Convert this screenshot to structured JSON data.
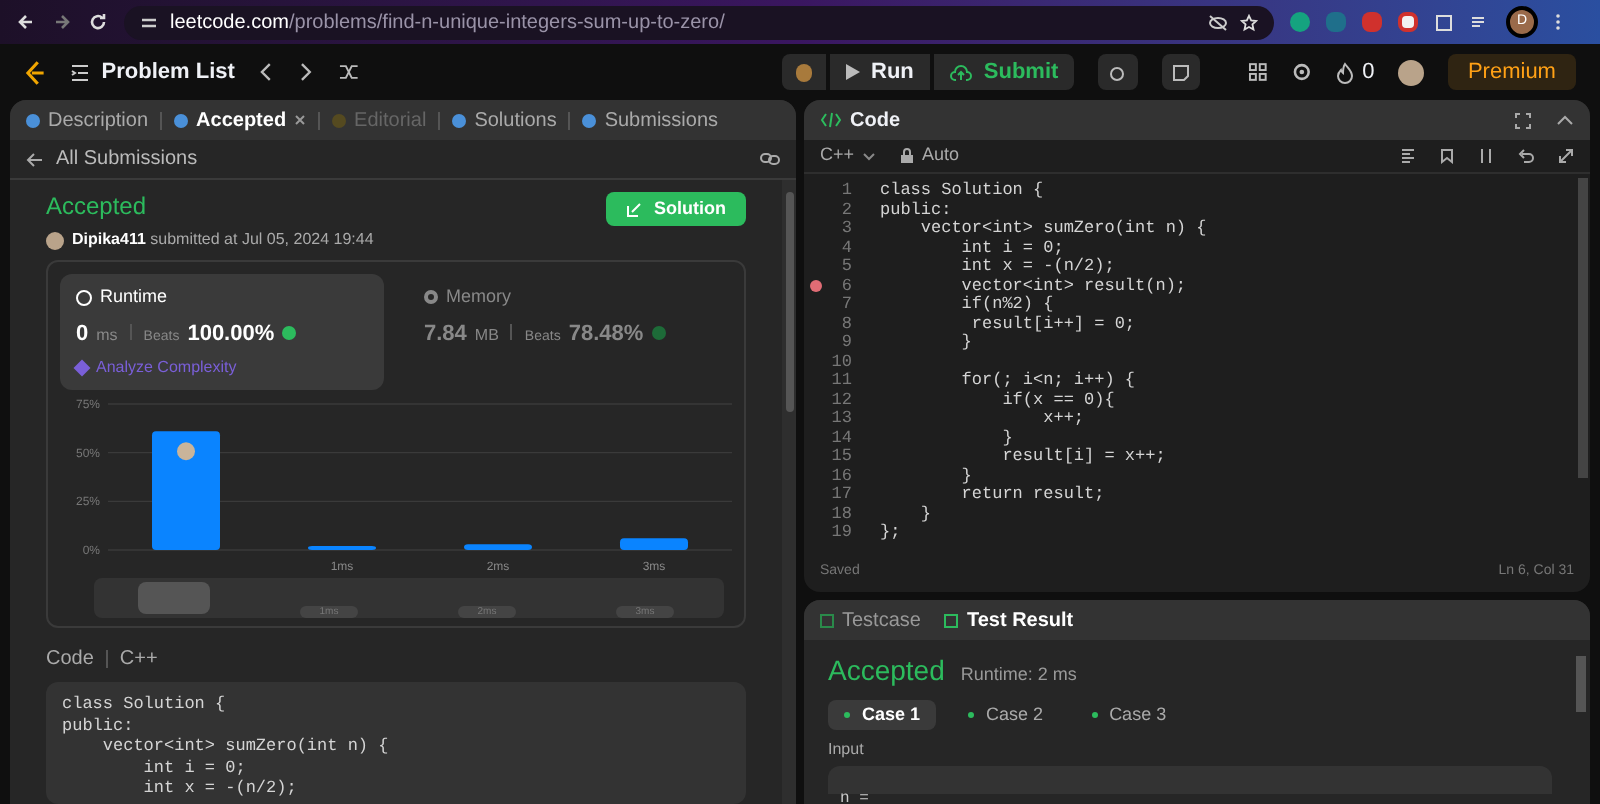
{
  "browser": {
    "url_host": "leetcode.com",
    "url_path": "/problems/find-n-unique-integers-sum-up-to-zero/",
    "profile_initial": "D"
  },
  "topbar": {
    "problem_list": "Problem List",
    "run": "Run",
    "submit": "Submit",
    "streak": "0",
    "premium": "Premium"
  },
  "left_tabs": [
    {
      "label": "Description",
      "selected": false,
      "disabled": false,
      "closable": false
    },
    {
      "label": "Accepted",
      "selected": true,
      "disabled": false,
      "closable": true
    },
    {
      "label": "Editorial",
      "selected": false,
      "disabled": true,
      "closable": false
    },
    {
      "label": "Solutions",
      "selected": false,
      "disabled": false,
      "closable": false
    },
    {
      "label": "Submissions",
      "selected": false,
      "disabled": false,
      "closable": false
    }
  ],
  "back_link": "All Submissions",
  "submission": {
    "status": "Accepted",
    "user": "Dipika411",
    "submitted": "submitted at Jul 05, 2024 19:44",
    "solution_button": "Solution"
  },
  "metrics": [
    {
      "kind": "runtime",
      "label": "Runtime",
      "value": "0",
      "unit": "ms",
      "beats_label": "Beats",
      "beats": "100.00%",
      "selected": true,
      "link": "Analyze Complexity"
    },
    {
      "kind": "memory",
      "label": "Memory",
      "value": "7.84",
      "unit": "MB",
      "beats_label": "Beats",
      "beats": "78.48%",
      "selected": false
    }
  ],
  "chart_data": {
    "type": "bar",
    "categories": [
      null,
      "1ms",
      "2ms",
      "3ms"
    ],
    "values": [
      61,
      2,
      3,
      6
    ],
    "ylim": [
      0,
      75
    ],
    "yticks": [
      {
        "value": 0,
        "label": "0%"
      },
      {
        "value": 25,
        "label": "25%"
      },
      {
        "value": 50,
        "label": "50%"
      },
      {
        "value": 75,
        "label": "75%"
      }
    ]
  },
  "brush_labels": [
    "1ms",
    "2ms",
    "3ms"
  ],
  "code_header": {
    "title": "Code",
    "language": "C++"
  },
  "left_code": [
    "class Solution {",
    "public:",
    "    vector<int> sumZero(int n) {",
    "        int i = 0;",
    "        int x = -(n/2);"
  ],
  "editor": {
    "title": "Code",
    "language": "C++",
    "mode": "Auto",
    "status": "Saved",
    "cursor": "Ln 6, Col 31",
    "lines": [
      {
        "num": "1",
        "text": "class Solution {",
        "breakpoint": false
      },
      {
        "num": "2",
        "text": "public:",
        "breakpoint": false
      },
      {
        "num": "3",
        "text": "    vector<int> sumZero(int n) {",
        "breakpoint": false
      },
      {
        "num": "4",
        "text": "        int i = 0;",
        "breakpoint": false
      },
      {
        "num": "5",
        "text": "        int x = -(n/2);",
        "breakpoint": false
      },
      {
        "num": "6",
        "text": "        vector<int> result(n);",
        "breakpoint": true
      },
      {
        "num": "7",
        "text": "        if(n%2) {",
        "breakpoint": false
      },
      {
        "num": "8",
        "text": "         result[i++] = 0;",
        "breakpoint": false
      },
      {
        "num": "9",
        "text": "        }",
        "breakpoint": false
      },
      {
        "num": "10",
        "breakpoint": false
      },
      {
        "num": "11",
        "text": "        for(; i<n; i++) {",
        "breakpoint": false
      },
      {
        "num": "12",
        "text": "            if(x == 0){",
        "breakpoint": false
      },
      {
        "num": "13",
        "text": "                x++;",
        "breakpoint": false
      },
      {
        "num": "14",
        "text": "            }",
        "breakpoint": false
      },
      {
        "num": "15",
        "text": "            result[i] = x++;",
        "breakpoint": false
      },
      {
        "num": "16",
        "text": "        }",
        "breakpoint": false
      },
      {
        "num": "17",
        "text": "        return result;",
        "breakpoint": false
      },
      {
        "num": "18",
        "text": "    }",
        "breakpoint": false
      },
      {
        "num": "19",
        "text": "};",
        "breakpoint": false
      }
    ]
  },
  "test_tabs": [
    {
      "label": "Testcase",
      "selected": false
    },
    {
      "label": "Test Result",
      "selected": true
    }
  ],
  "result": {
    "status": "Accepted",
    "runtime": "Runtime: 2 ms",
    "input_label": "Input",
    "input_value": "n ="
  },
  "cases": [
    {
      "label": "Case 1",
      "selected": true
    },
    {
      "label": "Case 2",
      "selected": false
    },
    {
      "label": "Case 3",
      "selected": false
    }
  ]
}
